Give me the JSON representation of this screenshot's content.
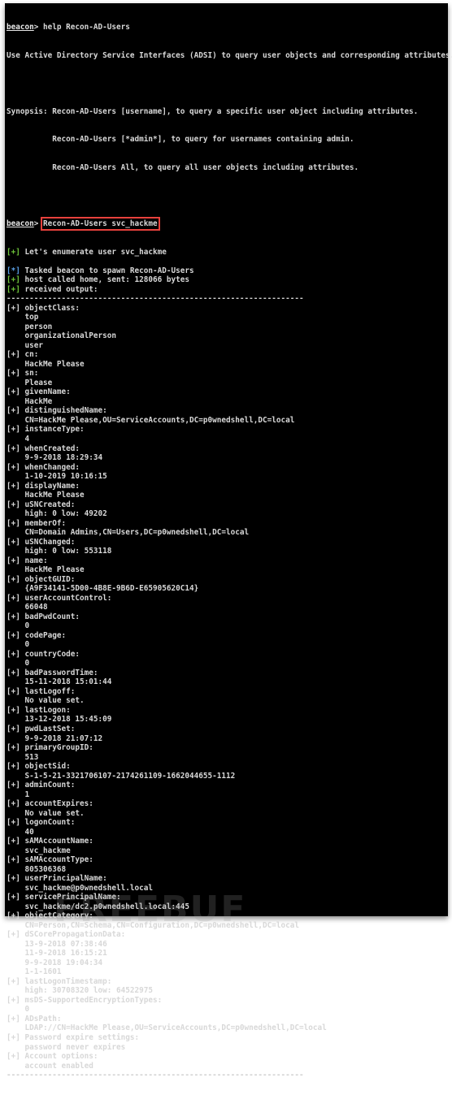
{
  "terminal": {
    "prompt": "beacon",
    "help_command": "help Recon-AD-Users",
    "help_description": "Use Active Directory Service Interfaces (ADSI) to query user objects and corresponding attributes.",
    "synopsis_label": "Synopsis: ",
    "synopsis": [
      "Recon-AD-Users [username], to query a specific user object including attributes.",
      "Recon-AD-Users [*admin*], to query for usernames containing admin.",
      "Recon-AD-Users All, to query all user objects including attributes."
    ],
    "command": "Recon-AD-Users svc_hackme",
    "highlight_color": "#e8413c",
    "status_lines": [
      {
        "tag": "[+]",
        "type": "plus",
        "text": " Let's enumerate user svc_hackme",
        "blank_after": true
      },
      {
        "tag": "[*]",
        "type": "star",
        "text": " Tasked beacon to spawn Recon-AD-Users"
      },
      {
        "tag": "[+]",
        "type": "plus",
        "text": " host called home, sent: 128066 bytes"
      },
      {
        "tag": "[+]",
        "type": "plus",
        "text": " received output:"
      }
    ],
    "separator": "-----------------------------------------------------------------",
    "attributes": [
      {
        "key": "objectClass:",
        "values": [
          "top",
          "person",
          "organizationalPerson",
          "user"
        ]
      },
      {
        "key": "cn:",
        "values": [
          "HackMe Please"
        ]
      },
      {
        "key": "sn:",
        "values": [
          "Please"
        ]
      },
      {
        "key": "givenName:",
        "values": [
          "HackMe"
        ]
      },
      {
        "key": "distinguishedName:",
        "values": [
          "CN=HackMe Please,OU=ServiceAccounts,DC=p0wnedshell,DC=local"
        ]
      },
      {
        "key": "instanceType:",
        "values": [
          "4"
        ]
      },
      {
        "key": "whenCreated:",
        "values": [
          "9-9-2018 18:29:34"
        ]
      },
      {
        "key": "whenChanged:",
        "values": [
          "1-10-2019 10:16:15"
        ]
      },
      {
        "key": "displayName:",
        "values": [
          "HackMe Please"
        ]
      },
      {
        "key": "uSNCreated:",
        "values": [
          "high: 0 low: 49202"
        ]
      },
      {
        "key": "memberOf:",
        "values": [
          "CN=Domain Admins,CN=Users,DC=p0wnedshell,DC=local"
        ]
      },
      {
        "key": "uSNChanged:",
        "values": [
          "high: 0 low: 553118"
        ]
      },
      {
        "key": "name:",
        "values": [
          "HackMe Please"
        ]
      },
      {
        "key": "objectGUID:",
        "values": [
          "{A9F34141-5D00-4B8E-9B6D-E65905620C14}"
        ]
      },
      {
        "key": "userAccountControl:",
        "values": [
          "66048"
        ]
      },
      {
        "key": "badPwdCount:",
        "values": [
          "0"
        ]
      },
      {
        "key": "codePage:",
        "values": [
          "0"
        ]
      },
      {
        "key": "countryCode:",
        "values": [
          "0"
        ]
      },
      {
        "key": "badPasswordTime:",
        "values": [
          "15-11-2018 15:01:44"
        ]
      },
      {
        "key": "lastLogoff:",
        "values": [
          "No value set."
        ]
      },
      {
        "key": "lastLogon:",
        "values": [
          "13-12-2018 15:45:09"
        ]
      },
      {
        "key": "pwdLastSet:",
        "values": [
          "9-9-2018 21:07:12"
        ]
      },
      {
        "key": "primaryGroupID:",
        "values": [
          "513"
        ]
      },
      {
        "key": "objectSid:",
        "values": [
          "S-1-5-21-3321706107-2174261109-1662044655-1112"
        ]
      },
      {
        "key": "adminCount:",
        "values": [
          "1"
        ]
      },
      {
        "key": "accountExpires:",
        "values": [
          "No value set."
        ]
      },
      {
        "key": "logonCount:",
        "values": [
          "40"
        ]
      },
      {
        "key": "sAMAccountName:",
        "values": [
          "svc_hackme"
        ]
      },
      {
        "key": "sAMAccountType:",
        "values": [
          "805306368"
        ]
      },
      {
        "key": "userPrincipalName:",
        "values": [
          "svc_hackme@p0wnedshell.local"
        ]
      },
      {
        "key": "servicePrincipalName:",
        "values": [
          "svc_hackme/dc2.p0wnedshell.local:445"
        ]
      },
      {
        "key": "objectCategory:",
        "values": [
          "CN=Person,CN=Schema,CN=Configuration,DC=p0wnedshell,DC=local"
        ]
      },
      {
        "key": "dSCorePropagationData:",
        "values": [
          "13-9-2018 07:38:46",
          "11-9-2018 16:15:21",
          "9-9-2018 19:04:34",
          "1-1-1601"
        ]
      },
      {
        "key": "lastLogonTimestamp:",
        "values": [
          "high: 30708320 low: 64522975"
        ]
      },
      {
        "key": "msDS-SupportedEncryptionTypes:",
        "values": [
          "0"
        ]
      },
      {
        "key": "ADsPath:",
        "values": [
          "LDAP://CN=HackMe Please,OU=ServiceAccounts,DC=p0wnedshell,DC=local"
        ]
      },
      {
        "key": "Password expire settings:",
        "values": [
          "password never expires"
        ]
      },
      {
        "key": "Account options:",
        "values": [
          "account enabled"
        ]
      }
    ],
    "plus_tag": "[+]",
    "value_indent": "    "
  },
  "colors": {
    "plus": "#6fc53a",
    "star": "#5aa0e6",
    "background": "#000000",
    "text": "#d8d8d8"
  },
  "watermark": "FREEBUF"
}
